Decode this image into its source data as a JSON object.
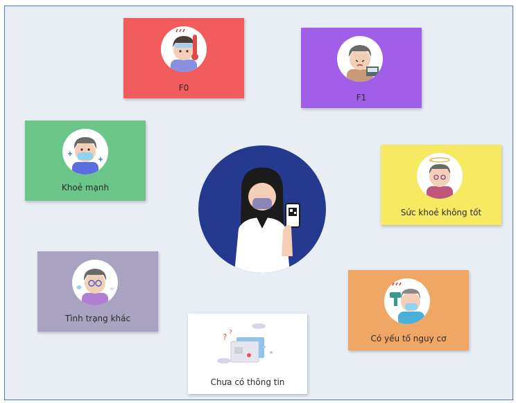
{
  "center": {
    "icon": "person-with-phone-qr-icon",
    "bg": "#253a8e"
  },
  "cards": {
    "f0": {
      "label": "F0",
      "color": "#f25c5c",
      "icon": "fever-thermometer-avatar-icon"
    },
    "f1": {
      "label": "F1",
      "color": "#a05fe6",
      "icon": "contact-avatar-icon"
    },
    "healthy": {
      "label": "Khoẻ mạnh",
      "color": "#6cc68a",
      "icon": "healthy-masked-avatar-icon"
    },
    "unwell": {
      "label": "Sức khoẻ không tốt",
      "color": "#f7ea63",
      "icon": "dizzy-avatar-icon"
    },
    "other": {
      "label": "Tình trạng khác",
      "color": "#a9a3c1",
      "icon": "other-condition-avatar-icon"
    },
    "risk": {
      "label": "Có yếu tố nguy cơ",
      "color": "#f0a664",
      "icon": "risk-temperature-check-avatar-icon"
    },
    "noinfo": {
      "label": "Chưa có thông tin",
      "color": "#ffffff",
      "icon": "no-info-document-icon"
    }
  }
}
